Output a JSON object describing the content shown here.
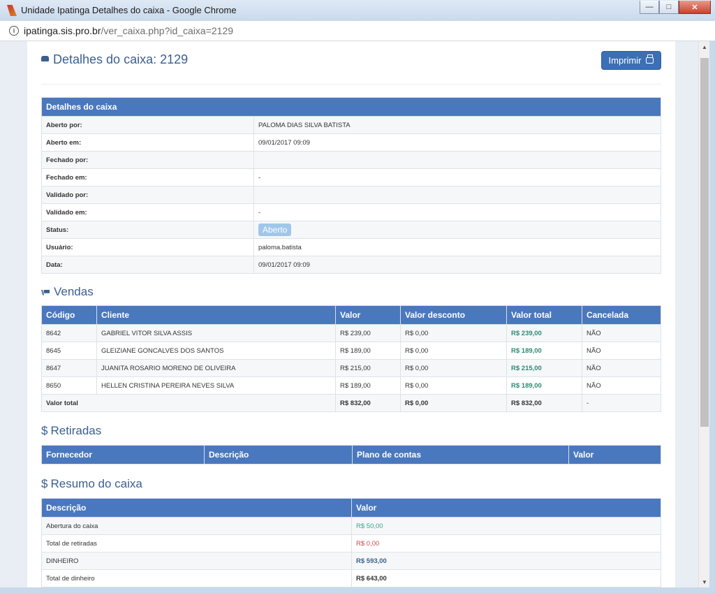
{
  "window": {
    "title": "Unidade Ipatinga Detalhes do caixa - Google Chrome",
    "url_host": "ipatinga.sis.pro.br",
    "url_path": "/ver_caixa.php?id_caixa=2129"
  },
  "page": {
    "title": "Detalhes do caixa: 2129",
    "print_label": "Imprimir"
  },
  "details": {
    "header": "Detalhes do caixa",
    "rows": [
      {
        "label": "Aberto por:",
        "value": "PALOMA DIAS SILVA BATISTA"
      },
      {
        "label": "Aberto em:",
        "value": "09/01/2017 09:09"
      },
      {
        "label": "Fechado por:",
        "value": ""
      },
      {
        "label": "Fechado em:",
        "value": "-"
      },
      {
        "label": "Validado por:",
        "value": ""
      },
      {
        "label": "Validado em:",
        "value": "-"
      },
      {
        "label": "Status:",
        "value": "Aberto"
      },
      {
        "label": "Usuário:",
        "value": "paloma.batista"
      },
      {
        "label": "Data:",
        "value": "09/01/2017 09:09"
      }
    ]
  },
  "vendas": {
    "title": "Vendas",
    "columns": [
      "Código",
      "Cliente",
      "Valor",
      "Valor desconto",
      "Valor total",
      "Cancelada"
    ],
    "rows": [
      [
        "8642",
        "GABRIEL VITOR SILVA ASSIS",
        "R$ 239,00",
        "R$ 0,00",
        "R$ 239,00",
        "NÃO"
      ],
      [
        "8645",
        "GLEIZIANE GONCALVES DOS SANTOS",
        "R$ 189,00",
        "R$ 0,00",
        "R$ 189,00",
        "NÃO"
      ],
      [
        "8647",
        "JUANITA ROSARIO MORENO DE OLIVEIRA",
        "R$ 215,00",
        "R$ 0,00",
        "R$ 215,00",
        "NÃO"
      ],
      [
        "8650",
        "HELLEN CRISTINA PEREIRA NEVES SILVA",
        "R$ 189,00",
        "R$ 0,00",
        "R$ 189,00",
        "NÃO"
      ]
    ],
    "total": {
      "label": "Valor total",
      "valor": "R$ 832,00",
      "desconto": "R$ 0,00",
      "total": "R$ 832,00",
      "cancelada": "-"
    }
  },
  "retiradas": {
    "title": "Retiradas",
    "columns": [
      "Fornecedor",
      "Descrição",
      "Plano de contas",
      "Valor"
    ]
  },
  "resumo": {
    "title": "Resumo do caixa",
    "columns": [
      "Descrição",
      "Valor"
    ],
    "rows": [
      {
        "label": "Abertura do caixa",
        "value": "R$ 50,00"
      },
      {
        "label": "Total de retiradas",
        "value": "R$ 0,00"
      },
      {
        "label": "DINHEIRO",
        "value": "R$ 593,00"
      },
      {
        "label": "Total de dinheiro",
        "value": "R$ 643,00"
      }
    ]
  },
  "colors": {
    "header_blue": "#4a78be",
    "title_blue": "#3a5f8f",
    "money_green": "#2d8a76",
    "money_red": "#c0504d",
    "badge_light_blue": "#9fc7ea"
  }
}
